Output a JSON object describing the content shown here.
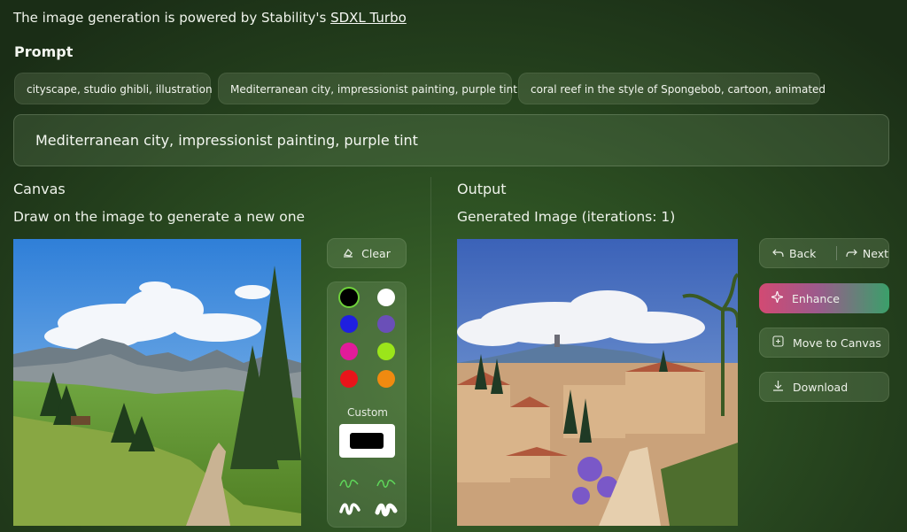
{
  "header": {
    "text": "The image generation is powered by Stability's ",
    "link": "SDXL Turbo"
  },
  "prompt": {
    "title": "Prompt",
    "suggestions": [
      "cityscape, studio ghibli, illustration",
      "Mediterranean city, impressionist painting, purple tint",
      "coral reef in the style of Spongebob, cartoon, animated"
    ],
    "value": "Mediterranean city, impressionist painting, purple tint"
  },
  "canvas": {
    "title": "Canvas",
    "subtitle": "Draw on the image to generate a new one",
    "clear_label": "Clear",
    "custom_label": "Custom",
    "colors": [
      "#000000",
      "#ffffff",
      "#1f1fe0",
      "#6a4fb8",
      "#e21b9a",
      "#9be51a",
      "#e8141a",
      "#f08a10"
    ],
    "custom_color": "#000000"
  },
  "output": {
    "title": "Output",
    "subtitle": "Generated Image (iterations: 1)",
    "back_label": "Back",
    "next_label": "Next",
    "enhance_label": "Enhance",
    "move_label": "Move to Canvas",
    "download_label": "Download"
  }
}
